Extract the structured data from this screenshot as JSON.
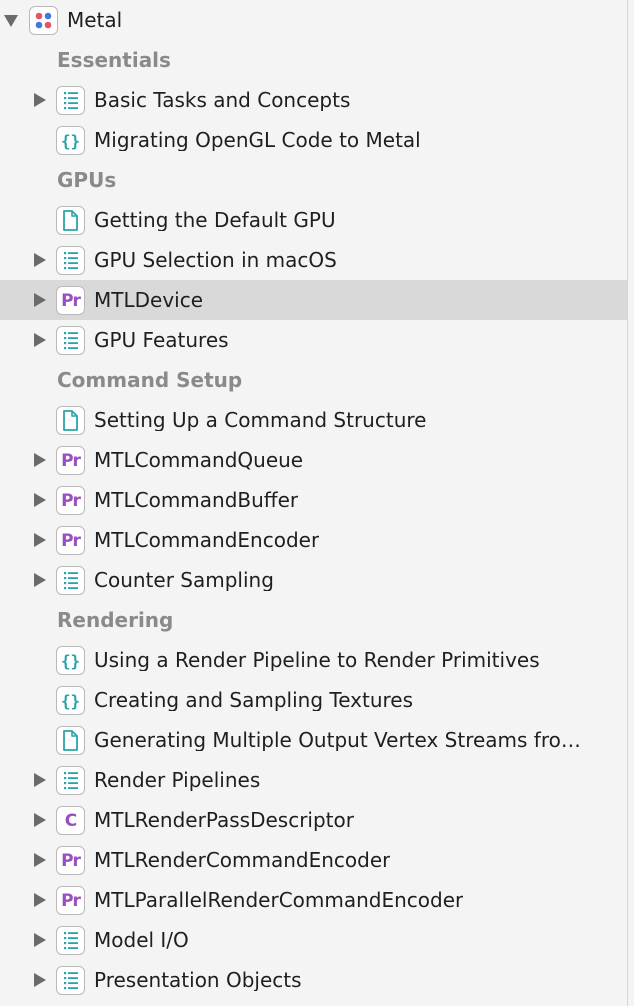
{
  "navigator": {
    "root": {
      "label": "Metal",
      "icon": "framework-icon",
      "expanded": true
    },
    "sections": [
      {
        "title": "Essentials",
        "items": [
          {
            "label": "Basic Tasks and Concepts",
            "icon": "list-icon",
            "expandable": true
          },
          {
            "label": "Migrating OpenGL Code to Metal",
            "icon": "sample-code-icon",
            "expandable": false
          }
        ]
      },
      {
        "title": "GPUs",
        "items": [
          {
            "label": "Getting the Default GPU",
            "icon": "article-icon",
            "expandable": false
          },
          {
            "label": "GPU Selection in macOS",
            "icon": "list-icon",
            "expandable": true
          },
          {
            "label": "MTLDevice",
            "icon": "protocol-icon",
            "icon_text": "Pr",
            "expandable": true,
            "selected": true
          },
          {
            "label": "GPU Features",
            "icon": "list-icon",
            "expandable": true
          }
        ]
      },
      {
        "title": "Command Setup",
        "items": [
          {
            "label": "Setting Up a Command Structure",
            "icon": "article-icon",
            "expandable": false
          },
          {
            "label": "MTLCommandQueue",
            "icon": "protocol-icon",
            "icon_text": "Pr",
            "expandable": true
          },
          {
            "label": "MTLCommandBuffer",
            "icon": "protocol-icon",
            "icon_text": "Pr",
            "expandable": true
          },
          {
            "label": "MTLCommandEncoder",
            "icon": "protocol-icon",
            "icon_text": "Pr",
            "expandable": true
          },
          {
            "label": "Counter Sampling",
            "icon": "list-icon",
            "expandable": true
          }
        ]
      },
      {
        "title": "Rendering",
        "items": [
          {
            "label": "Using a Render Pipeline to Render Primitives",
            "icon": "sample-code-icon",
            "expandable": false
          },
          {
            "label": "Creating and Sampling Textures",
            "icon": "sample-code-icon",
            "expandable": false
          },
          {
            "label": "Generating Multiple Output Vertex Streams fro…",
            "icon": "article-icon",
            "expandable": false
          },
          {
            "label": "Render Pipelines",
            "icon": "list-icon",
            "expandable": true
          },
          {
            "label": "MTLRenderPassDescriptor",
            "icon": "class-icon",
            "icon_text": "C",
            "expandable": true
          },
          {
            "label": "MTLRenderCommandEncoder",
            "icon": "protocol-icon",
            "icon_text": "Pr",
            "expandable": true
          },
          {
            "label": "MTLParallelRenderCommandEncoder",
            "icon": "protocol-icon",
            "icon_text": "Pr",
            "expandable": true
          },
          {
            "label": "Model I/O",
            "icon": "list-icon",
            "expandable": true
          },
          {
            "label": "Presentation Objects",
            "icon": "list-icon",
            "expandable": true
          }
        ]
      }
    ]
  },
  "colors": {
    "background": "#f4f4f4",
    "selected_row": "#d9d9d9",
    "section_title": "#8a8a8a",
    "teal_icon": "#2aa3a8",
    "protocol_purple": "#9b4fbf",
    "disclosure": "#6b6b6b"
  }
}
